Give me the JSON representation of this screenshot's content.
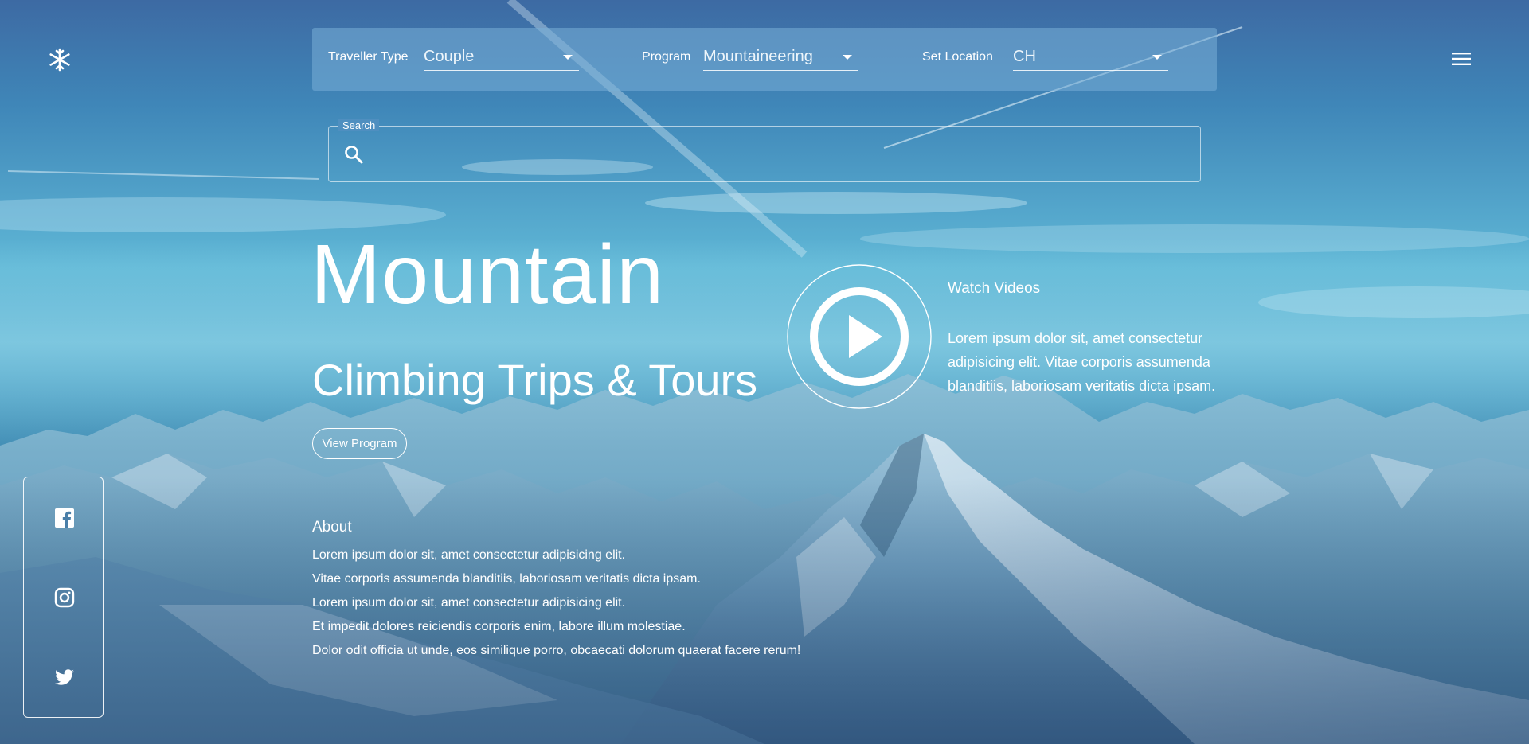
{
  "header": {
    "logo_icon": "snowflake-icon",
    "menu_icon": "hamburger-menu-icon"
  },
  "filters": {
    "traveller_type": {
      "label": "Traveller Type",
      "value": "Couple"
    },
    "program": {
      "label": "Program",
      "value": "Mountaineering"
    },
    "location": {
      "label": "Set Location",
      "value": "CH"
    }
  },
  "search": {
    "label": "Search",
    "value": "",
    "icon": "search-icon"
  },
  "hero": {
    "title": "Mountain",
    "subtitle": "Climbing Trips & Tours",
    "button_label": "View Program"
  },
  "video": {
    "icon": "play-circle-icon",
    "title": "Watch Videos",
    "text": "Lorem ipsum dolor sit, amet consectetur adipisicing elit. Vitae corporis assumenda blanditiis, laboriosam veritatis dicta ipsam."
  },
  "social": {
    "icons": [
      "facebook-icon",
      "instagram-icon",
      "twitter-icon"
    ]
  },
  "about": {
    "title": "About",
    "lines": [
      "Lorem ipsum dolor sit, amet consectetur adipisicing elit.",
      "Vitae corporis assumenda blanditiis, laboriosam veritatis dicta ipsam.",
      "Lorem ipsum dolor sit, amet consectetur adipisicing elit.",
      "Et impedit dolores reiciendis corporis enim, labore illum molestiae.",
      "Dolor odit officia ut unde, eos similique porro, obcaecati dolorum quaerat facere rerum!"
    ]
  },
  "colors": {
    "sky_top": "#3d6aa3",
    "sky_mid": "#5fb7d6",
    "mountain_snow": "#c9dbe9",
    "mountain_rock": "#2f5776",
    "text": "#ffffff"
  }
}
